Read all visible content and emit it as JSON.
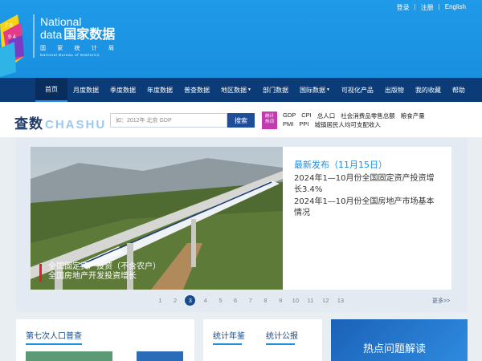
{
  "header": {
    "top_links": [
      "登录",
      "注册",
      "English"
    ],
    "separator": "|",
    "logo_en_line1": "National",
    "logo_en_line2": "data",
    "logo_cn": "国家数据",
    "logo_sub_cn": "国 家 统 计 局",
    "logo_sub_en": "National Bureau of Statistics"
  },
  "nav": {
    "items": [
      {
        "label": "首页",
        "active": true,
        "dropdown": false
      },
      {
        "label": "月度数据",
        "dropdown": false
      },
      {
        "label": "季度数据",
        "dropdown": false
      },
      {
        "label": "年度数据",
        "dropdown": false
      },
      {
        "label": "普查数据",
        "dropdown": false
      },
      {
        "label": "地区数据",
        "dropdown": true
      },
      {
        "label": "部门数据",
        "dropdown": false
      },
      {
        "label": "国际数据",
        "dropdown": true
      },
      {
        "label": "可视化产品",
        "dropdown": false
      },
      {
        "label": "出版物",
        "dropdown": false
      },
      {
        "label": "我的收藏",
        "dropdown": false
      },
      {
        "label": "帮助",
        "dropdown": false
      }
    ]
  },
  "search": {
    "brand_cn": "查数",
    "brand_en": "CHASHU",
    "placeholder": "如：2012年 北京 GDP",
    "button_label": "搜索",
    "hot_badge_line1": "统计",
    "hot_badge_line2": "热词",
    "hot_row1": [
      "GDP",
      "CPI",
      "总人口",
      "社会消费品零售总额",
      "粮食产量"
    ],
    "hot_row2": [
      "PMI",
      "PPI",
      "城镇居民人均可支配收入"
    ]
  },
  "carousel": {
    "caption_line1": "全国固定资产投资（不含农户）",
    "caption_line2": "全国房地产开发投资增长",
    "news_title": "最新发布（11月15日）",
    "news_items": [
      "2024年1—10月份全国固定资产投资增长3.4%",
      "2024年1—10月份全国房地产市场基本情况"
    ],
    "pages": [
      "1",
      "2",
      "3",
      "4",
      "5",
      "6",
      "7",
      "8",
      "9",
      "10",
      "11",
      "12",
      "13"
    ],
    "active_page": "3",
    "more_label": "更多>>"
  },
  "panels": {
    "census_title": "第七次人口普查",
    "yearbook_title": "统计年鉴",
    "bulletin_title": "统计公报",
    "hot_topics_title": "热点问题解读"
  },
  "colors": {
    "header_blue": "#1a8fe0",
    "nav_navy": "#0b3c78",
    "accent": "#174b8f",
    "hot_badge": "#c33bb0"
  }
}
